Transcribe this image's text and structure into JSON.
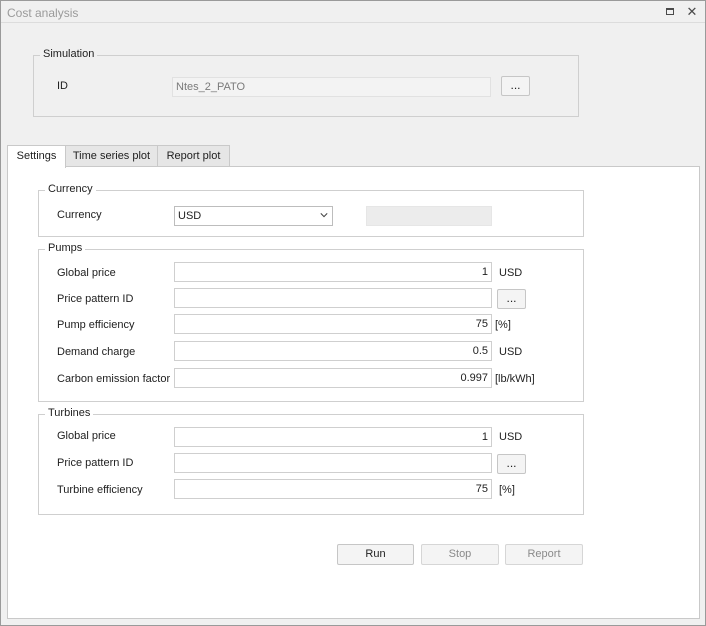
{
  "window": {
    "title": "Cost analysis"
  },
  "simulation": {
    "group_label": "Simulation",
    "id_label": "ID",
    "id_value": "Ntes_2_PATO",
    "browse_label": "..."
  },
  "tabs": [
    {
      "label": "Settings",
      "active": true
    },
    {
      "label": "Time series plot",
      "active": false
    },
    {
      "label": "Report plot",
      "active": false
    }
  ],
  "currency": {
    "group_label": "Currency",
    "label": "Currency",
    "selected": "USD"
  },
  "pumps": {
    "group_label": "Pumps",
    "global_price_label": "Global price",
    "global_price_value": "1",
    "global_price_unit": "USD",
    "price_pattern_label": "Price pattern ID",
    "price_pattern_value": "",
    "price_pattern_browse": "...",
    "efficiency_label": "Pump efficiency",
    "efficiency_value": "75",
    "efficiency_unit": "[%]",
    "demand_label": "Demand charge",
    "demand_value": "0.5",
    "demand_unit": "USD",
    "carbon_label": "Carbon emission factor",
    "carbon_value": "0.997",
    "carbon_unit": "[lb/kWh]"
  },
  "turbines": {
    "group_label": "Turbines",
    "global_price_label": "Global price",
    "global_price_value": "1",
    "global_price_unit": "USD",
    "price_pattern_label": "Price pattern ID",
    "price_pattern_value": "",
    "price_pattern_browse": "...",
    "efficiency_label": "Turbine efficiency",
    "efficiency_value": "75",
    "efficiency_unit": "[%]"
  },
  "actions": {
    "run": "Run",
    "stop": "Stop",
    "report": "Report"
  }
}
